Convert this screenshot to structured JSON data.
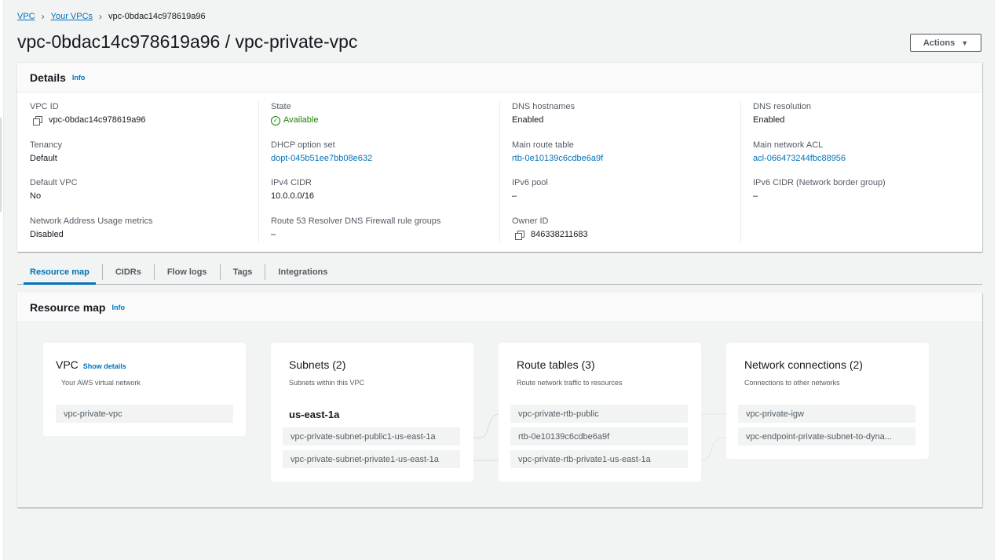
{
  "breadcrumb": {
    "vpc": "VPC",
    "your_vpcs": "Your VPCs",
    "current": "vpc-0bdac14c978619a96"
  },
  "page": {
    "title": "vpc-0bdac14c978619a96 / vpc-private-vpc",
    "actions_label": "Actions"
  },
  "details": {
    "heading": "Details",
    "info": "Info",
    "columns": [
      [
        {
          "label": "VPC ID",
          "value": "vpc-0bdac14c978619a96"
        },
        {
          "label": "Tenancy",
          "value": "Default"
        },
        {
          "label": "Default VPC",
          "value": "No"
        },
        {
          "label": "Network Address Usage metrics",
          "value": "Disabled"
        }
      ],
      [
        {
          "label": "State",
          "value": "Available"
        },
        {
          "label": "DHCP option set",
          "value": "dopt-045b51ee7bb08e632"
        },
        {
          "label": "IPv4 CIDR",
          "value": "10.0.0.0/16"
        },
        {
          "label": "Route 53 Resolver DNS Firewall rule groups",
          "value": "–"
        }
      ],
      [
        {
          "label": "DNS hostnames",
          "value": "Enabled"
        },
        {
          "label": "Main route table",
          "value": "rtb-0e10139c6cdbe6a9f"
        },
        {
          "label": "IPv6 pool",
          "value": "–"
        },
        {
          "label": "Owner ID",
          "value": "846338211683"
        }
      ],
      [
        {
          "label": "DNS resolution",
          "value": "Enabled"
        },
        {
          "label": "Main network ACL",
          "value": "acl-066473244fbc88956"
        },
        {
          "label": "IPv6 CIDR (Network border group)",
          "value": "–"
        }
      ]
    ]
  },
  "tabs": [
    "Resource map",
    "CIDRs",
    "Flow logs",
    "Tags",
    "Integrations"
  ],
  "resource_map": {
    "heading": "Resource map",
    "info": "Info",
    "vpc_card": {
      "title": "VPC",
      "show_details": "Show details",
      "subtitle": "Your AWS virtual network",
      "items": [
        "vpc-private-vpc"
      ]
    },
    "subnets_card": {
      "title": "Subnets (2)",
      "subtitle": "Subnets within this VPC",
      "az": "us-east-1a",
      "items": [
        "vpc-private-subnet-public1-us-east-1a",
        "vpc-private-subnet-private1-us-east-1a"
      ]
    },
    "routes_card": {
      "title": "Route tables (3)",
      "subtitle": "Route network traffic to resources",
      "items": [
        "vpc-private-rtb-public",
        "rtb-0e10139c6cdbe6a9f",
        "vpc-private-rtb-private1-us-east-1a"
      ]
    },
    "network_card": {
      "title": "Network connections (2)",
      "subtitle": "Connections to other networks",
      "items": [
        "vpc-private-igw",
        "vpc-endpoint-private-subnet-to-dyna..."
      ]
    }
  },
  "colors": {
    "link": "#0073bb",
    "success": "#1d8102",
    "text": "#16191f",
    "muted": "#545b64"
  }
}
